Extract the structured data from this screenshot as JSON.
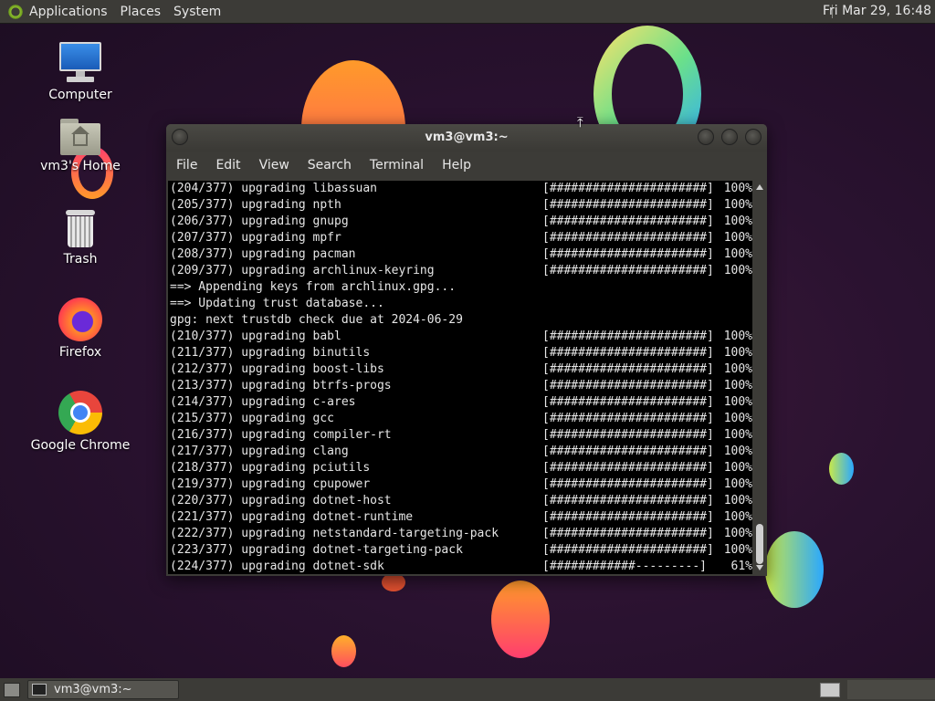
{
  "top_panel": {
    "menus": [
      "Applications",
      "Places",
      "System"
    ],
    "clock": "Fri Mar 29, 16:48"
  },
  "desktop_icons": [
    {
      "label": "Computer",
      "icon": "computer-icon"
    },
    {
      "label": "vm3's Home",
      "icon": "home-folder-icon"
    },
    {
      "label": "Trash",
      "icon": "trash-icon"
    },
    {
      "label": "Firefox",
      "icon": "firefox-icon"
    },
    {
      "label": "Google Chrome",
      "icon": "chrome-icon"
    }
  ],
  "terminal": {
    "title": "vm3@vm3:~",
    "menus": [
      "File",
      "Edit",
      "View",
      "Search",
      "Terminal",
      "Help"
    ],
    "lines": [
      {
        "text": "(204/377) upgrading libassuan",
        "bar": "[######################]",
        "pct": "100%"
      },
      {
        "text": "(205/377) upgrading npth",
        "bar": "[######################]",
        "pct": "100%"
      },
      {
        "text": "(206/377) upgrading gnupg",
        "bar": "[######################]",
        "pct": "100%"
      },
      {
        "text": "(207/377) upgrading mpfr",
        "bar": "[######################]",
        "pct": "100%"
      },
      {
        "text": "(208/377) upgrading pacman",
        "bar": "[######################]",
        "pct": "100%"
      },
      {
        "text": "(209/377) upgrading archlinux-keyring",
        "bar": "[######################]",
        "pct": "100%"
      },
      {
        "text": "==> Appending keys from archlinux.gpg...",
        "bar": "",
        "pct": ""
      },
      {
        "text": "==> Updating trust database...",
        "bar": "",
        "pct": ""
      },
      {
        "text": "gpg: next trustdb check due at 2024-06-29",
        "bar": "",
        "pct": ""
      },
      {
        "text": "(210/377) upgrading babl",
        "bar": "[######################]",
        "pct": "100%"
      },
      {
        "text": "(211/377) upgrading binutils",
        "bar": "[######################]",
        "pct": "100%"
      },
      {
        "text": "(212/377) upgrading boost-libs",
        "bar": "[######################]",
        "pct": "100%"
      },
      {
        "text": "(213/377) upgrading btrfs-progs",
        "bar": "[######################]",
        "pct": "100%"
      },
      {
        "text": "(214/377) upgrading c-ares",
        "bar": "[######################]",
        "pct": "100%"
      },
      {
        "text": "(215/377) upgrading gcc",
        "bar": "[######################]",
        "pct": "100%"
      },
      {
        "text": "(216/377) upgrading compiler-rt",
        "bar": "[######################]",
        "pct": "100%"
      },
      {
        "text": "(217/377) upgrading clang",
        "bar": "[######################]",
        "pct": "100%"
      },
      {
        "text": "(218/377) upgrading pciutils",
        "bar": "[######################]",
        "pct": "100%"
      },
      {
        "text": "(219/377) upgrading cpupower",
        "bar": "[######################]",
        "pct": "100%"
      },
      {
        "text": "(220/377) upgrading dotnet-host",
        "bar": "[######################]",
        "pct": "100%"
      },
      {
        "text": "(221/377) upgrading dotnet-runtime",
        "bar": "[######################]",
        "pct": "100%"
      },
      {
        "text": "(222/377) upgrading netstandard-targeting-pack",
        "bar": "[######################]",
        "pct": "100%"
      },
      {
        "text": "(223/377) upgrading dotnet-targeting-pack",
        "bar": "[######################]",
        "pct": "100%"
      },
      {
        "text": "(224/377) upgrading dotnet-sdk",
        "bar": "[############---------]",
        "pct": "61%"
      }
    ]
  },
  "taskbar": {
    "tasks": [
      {
        "label": "vm3@vm3:~"
      }
    ]
  },
  "colors": {
    "panel": "#3c3b37",
    "terminal_bg": "#000000",
    "terminal_fg": "#e6e6e6"
  }
}
